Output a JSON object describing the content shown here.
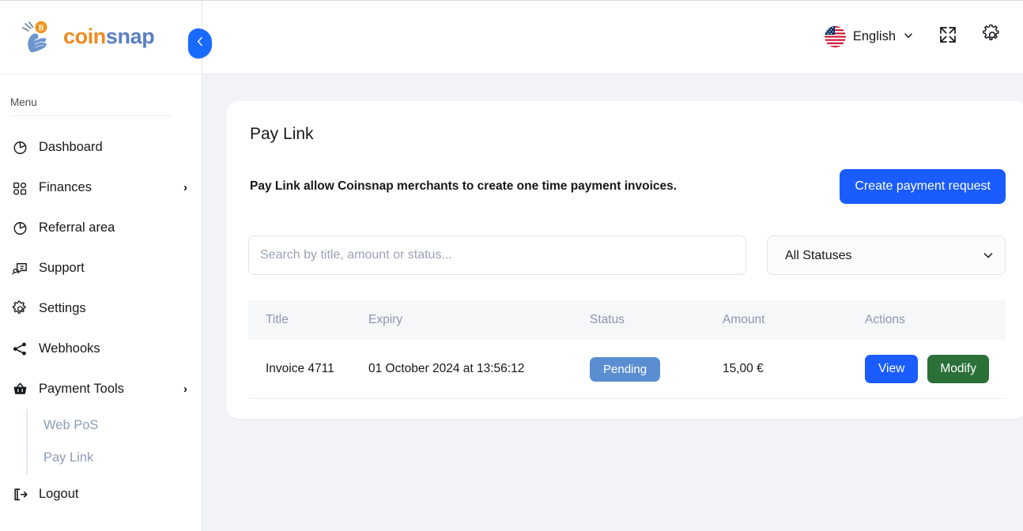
{
  "brand": {
    "name_part1": "coin",
    "name_part2": "snap",
    "logo_icon": "hand-flipping-bitcoin-coin-icon",
    "accent_orange": "#ef8a1f",
    "accent_blue": "#5b7fc4"
  },
  "sidebar": {
    "menu_label": "Menu",
    "collapse_icon": "chevron-left-icon",
    "items": [
      {
        "label": "Dashboard",
        "icon": "pie-chart-icon",
        "has_caret": false
      },
      {
        "label": "Finances",
        "icon": "grid-icon",
        "has_caret": true,
        "caret": "›"
      },
      {
        "label": "Referral area",
        "icon": "pie-chart-icon",
        "has_caret": false
      },
      {
        "label": "Support",
        "icon": "chat-bubble-icon",
        "has_caret": false
      },
      {
        "label": "Settings",
        "icon": "gear-icon",
        "has_caret": false
      },
      {
        "label": "Webhooks",
        "icon": "share-nodes-icon",
        "has_caret": false
      },
      {
        "label": "Payment Tools",
        "icon": "basket-icon",
        "has_caret": true,
        "caret": "›"
      }
    ],
    "sub_items": [
      {
        "label": "Web PoS"
      },
      {
        "label": "Pay Link"
      }
    ],
    "logout": {
      "label": "Logout",
      "icon": "logout-icon"
    }
  },
  "topbar": {
    "language": "English",
    "language_flag": "us-flag-icon",
    "language_chevron": "chevron-down-icon",
    "fullscreen_icon": "expand-fullscreen-icon",
    "settings_icon": "gear-icon"
  },
  "main": {
    "title": "Pay Link",
    "description": "Pay Link allow Coinsnap merchants to create one time payment invoices.",
    "create_button": "Create payment request",
    "search": {
      "placeholder": "Search by title, amount or status...",
      "value": ""
    },
    "status_filter": {
      "selected": "All Statuses",
      "options": [
        "All Statuses"
      ],
      "chevron": "chevron-down-icon"
    },
    "table": {
      "columns": [
        "Title",
        "Expiry",
        "Status",
        "Amount",
        "Actions"
      ],
      "rows": [
        {
          "title": "Invoice 4711",
          "expiry": "01 October 2024 at 13:56:12",
          "status": "Pending",
          "amount": "15,00 €",
          "actions": {
            "view": "View",
            "modify": "Modify"
          }
        }
      ]
    }
  },
  "colors": {
    "primary_blue": "#1a5cff",
    "status_pending": "#5b8ed1",
    "modify_green": "#2a7038",
    "content_bg": "#f1f3f7"
  }
}
